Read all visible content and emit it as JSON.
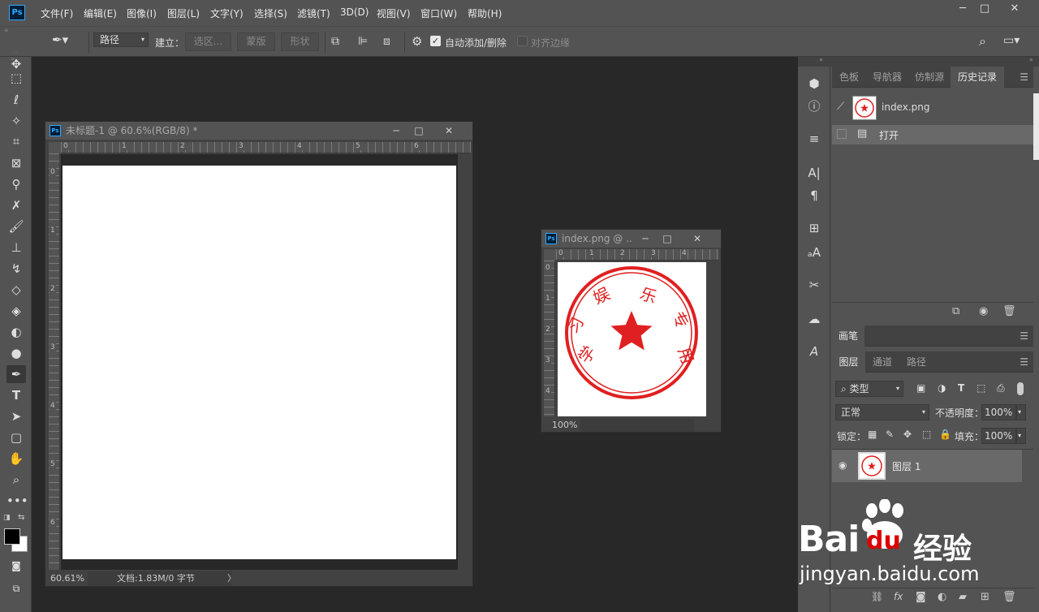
{
  "app": {
    "logo_text": "Ps"
  },
  "menu": [
    "文件(F)",
    "编辑(E)",
    "图像(I)",
    "图层(L)",
    "文字(Y)",
    "选择(S)",
    "滤镜(T)",
    "3D(D)",
    "视图(V)",
    "窗口(W)",
    "帮助(H)"
  ],
  "window_controls": {
    "minimize": "─",
    "restore": "□",
    "close": "✕"
  },
  "options": {
    "mode_select": "路径",
    "make_label": "建立：",
    "selection_btn": "选区...",
    "mask_btn": "蒙版",
    "shape_btn": "形状",
    "auto_add_delete": "自动添加/删除",
    "auto_add_checked": true,
    "align_edges": "对齐边缘"
  },
  "doc1": {
    "title": "未标题-1 @ 60.6%(RGB/8) *",
    "ruler_h": [
      "0",
      "1",
      "2",
      "3",
      "4",
      "5",
      "6"
    ],
    "ruler_v": [
      "0",
      "1",
      "2",
      "3",
      "4",
      "5",
      "6"
    ],
    "zoom": "60.61%",
    "status": "文档:1.83M/0 字节",
    "arrow": "〉"
  },
  "doc2": {
    "title": "index.png @ ...",
    "ruler_h": [
      "0",
      "1",
      "2",
      "3",
      "4"
    ],
    "ruler_v": [
      "0",
      "1",
      "2",
      "3",
      "4"
    ],
    "zoom": "100%",
    "seal_top_chars": [
      "学",
      "习",
      "娱",
      "乐",
      "专",
      "用"
    ]
  },
  "history_panel": {
    "tabs": [
      "色板",
      "导航器",
      "仿制源",
      "历史记录"
    ],
    "active_tab": 3,
    "snapshot": "index.png",
    "steps": [
      "打开"
    ]
  },
  "brush_panel": {
    "title": "画笔"
  },
  "layers_panel": {
    "tabs": [
      "图层",
      "通道",
      "路径"
    ],
    "active_tab": 0,
    "filter_label": "类型",
    "blend_mode": "正常",
    "opacity_label": "不透明度：",
    "opacity": "100%",
    "lock_label": "锁定：",
    "fill_label": "填充：",
    "fill": "100%",
    "layers": [
      {
        "name": "图层 1",
        "visible": true
      }
    ]
  },
  "watermark": {
    "brand": "Bai",
    "brand2": "du",
    "cn": "经验",
    "url": "jingyan.baidu.com"
  },
  "colors": {
    "seal_red": "#e02020",
    "accent": "#31a8ff",
    "bg_canvas": "#282828",
    "panel": "#535353"
  }
}
